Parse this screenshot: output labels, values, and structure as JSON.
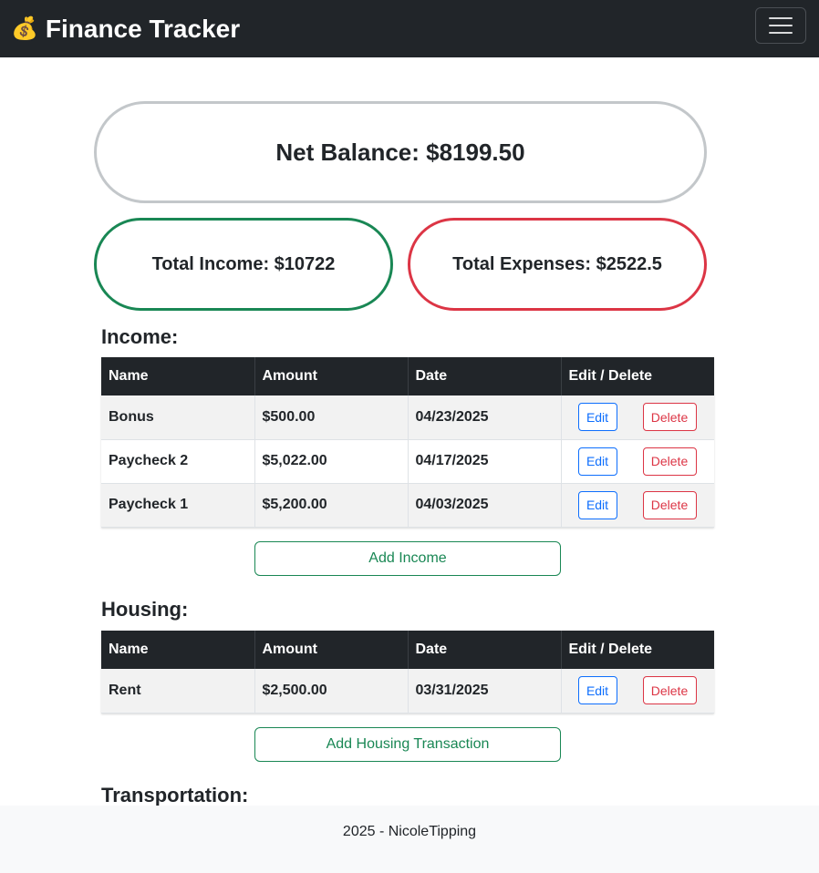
{
  "navbar": {
    "brand_emoji": "💰",
    "brand_title": "Finance Tracker",
    "toggle_icon": "hamburger-menu-icon"
  },
  "summary": {
    "net_balance": "Net Balance: $8199.50",
    "total_income": "Total Income: $10722",
    "total_expenses": "Total Expenses: $2522.5"
  },
  "colors": {
    "navbar": "#212529",
    "income_accent": "#198754",
    "expense_accent": "#dc3545",
    "edit_accent": "#0d6efd",
    "net_border": "#c3c7ca"
  },
  "table_headers": [
    "Name",
    "Amount",
    "Date",
    "Edit / Delete"
  ],
  "row_actions": {
    "edit": "Edit",
    "delete": "Delete"
  },
  "income": {
    "title": "Income:",
    "rows": [
      {
        "name": "Bonus",
        "amount": "$500.00",
        "date": "04/23/2025"
      },
      {
        "name": "Paycheck 2",
        "amount": "$5,022.00",
        "date": "04/17/2025"
      },
      {
        "name": "Paycheck 1",
        "amount": "$5,200.00",
        "date": "04/03/2025"
      }
    ],
    "add_label": "Add Income"
  },
  "housing": {
    "title": "Housing:",
    "rows": [
      {
        "name": "Rent",
        "amount": "$2,500.00",
        "date": "03/31/2025"
      }
    ],
    "add_label": "Add Housing Transaction"
  },
  "transportation": {
    "title": "Transportation:"
  },
  "footer": {
    "text": "2025 - NicoleTipping"
  }
}
